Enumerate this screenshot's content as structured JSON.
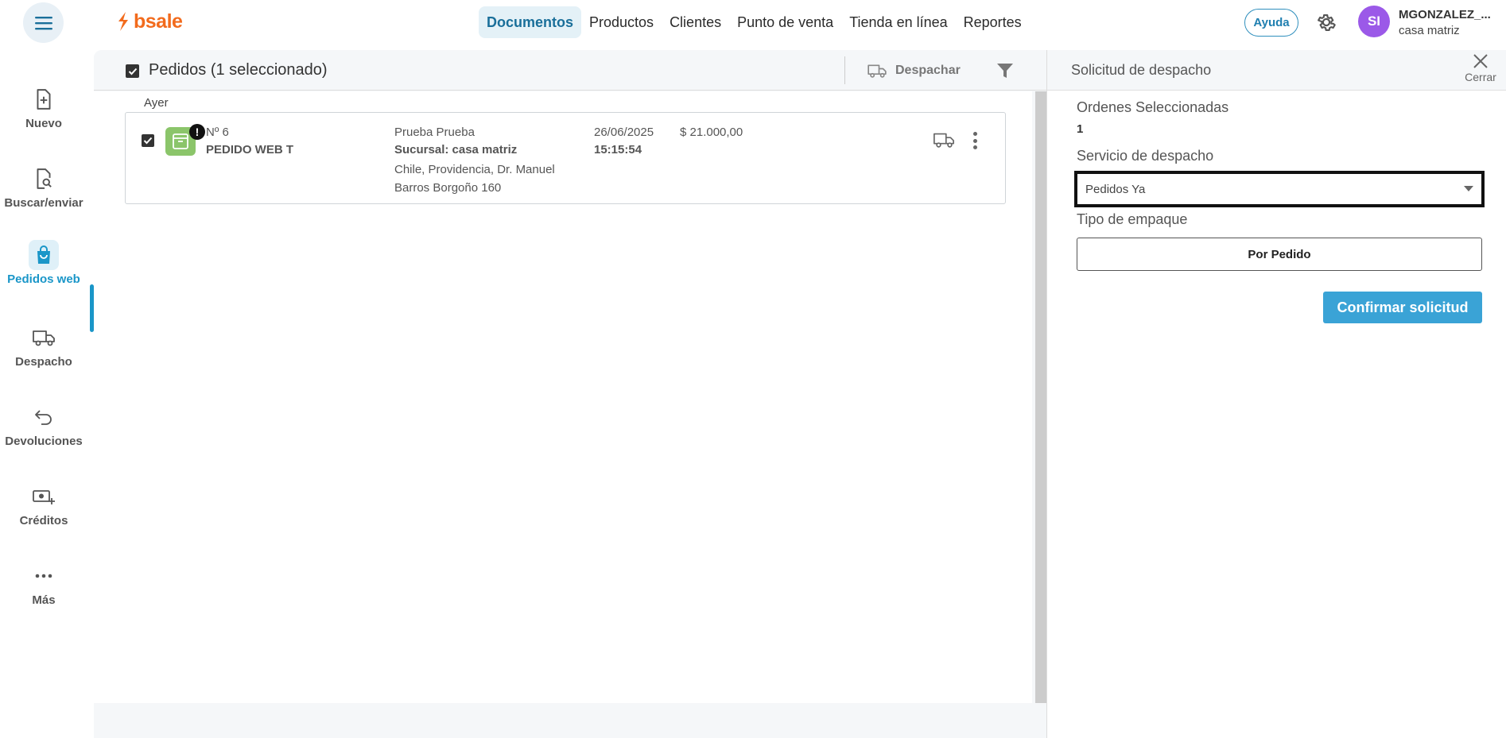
{
  "header": {
    "logo_text": "bsale",
    "nav": [
      {
        "label": "Documentos",
        "active": true
      },
      {
        "label": "Productos",
        "active": false
      },
      {
        "label": "Clientes",
        "active": false
      },
      {
        "label": "Punto de venta",
        "active": false
      },
      {
        "label": "Tienda en línea",
        "active": false
      },
      {
        "label": "Reportes",
        "active": false
      }
    ],
    "help_label": "Ayuda",
    "avatar_initials": "SI",
    "user_name": "MGONZALEZ_...",
    "user_branch": "casa matriz",
    "accent_color": "#1a96c8",
    "brand_color": "#f26b1d"
  },
  "sidebar": {
    "items": [
      {
        "label": "Nuevo",
        "icon": "new-document-icon"
      },
      {
        "label": "Buscar/enviar",
        "icon": "search-document-icon"
      },
      {
        "label": "Pedidos web",
        "icon": "shopping-bag-icon",
        "active": true
      },
      {
        "label": "Despacho",
        "icon": "truck-icon"
      },
      {
        "label": "Devoluciones",
        "icon": "return-arrow-icon"
      },
      {
        "label": "Créditos",
        "icon": "money-plus-icon"
      },
      {
        "label": "Más",
        "icon": "more-dots-icon"
      }
    ]
  },
  "list": {
    "title": "Pedidos (1 seleccionado)",
    "dispatch_label": "Despachar",
    "day_label": "Ayer",
    "orders": [
      {
        "number": "Nº 6",
        "type": "PEDIDO WEB T",
        "customer": "Prueba Prueba",
        "branch": "Sucursal: casa matriz",
        "address": "Chile, Providencia, Dr. Manuel Barros Borgoño 160",
        "date": "26/06/2025",
        "time": "15:15:54",
        "amount": "$ 21.000,00",
        "alert": "!"
      }
    ]
  },
  "panel": {
    "title": "Solicitud de despacho",
    "close_label": "Cerrar",
    "selected_label": "Ordenes Seleccionadas",
    "selected_count": "1",
    "service_label": "Servicio de despacho",
    "service_value": "Pedidos Ya",
    "packing_label": "Tipo de empaque",
    "packing_value": "Por Pedido",
    "confirm_label": "Confirmar solicitud"
  }
}
